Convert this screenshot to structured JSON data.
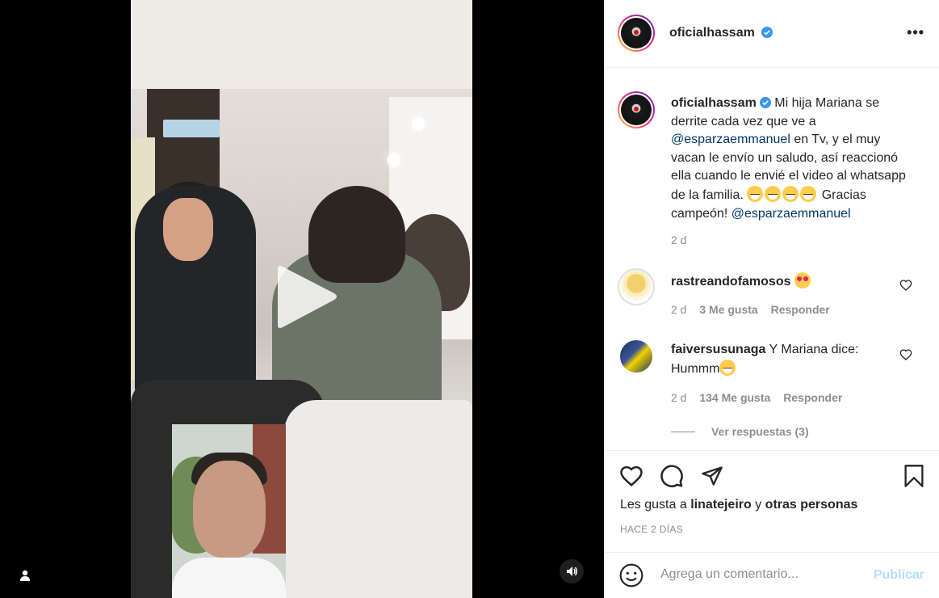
{
  "post": {
    "username": "oficialhassam",
    "more_label": "•••"
  },
  "caption": {
    "username": "oficialhassam",
    "text_before_mention": "Mi hija Mariana se derrite cada vez que ve a",
    "mention1": "@esparzaemmanuel",
    "text_middle": "en Tv, y el muy vacan le envío un saludo, así reaccionó ella cuando le envié el video al whatsapp de la familia.",
    "text_after_emojis": "Gracias campeón!",
    "mention2": "@esparzaemmanuel",
    "time": "2 d"
  },
  "comments": [
    {
      "username": "rastreandofamosos",
      "text": "",
      "time": "2 d",
      "likes": "3 Me gusta",
      "reply": "Responder"
    },
    {
      "username": "faiversusunaga",
      "text": "Y Mariana dice: Hummm",
      "time": "2 d",
      "likes": "134 Me gusta",
      "reply": "Responder",
      "view_replies": "Ver respuestas (3)"
    }
  ],
  "likes_line": {
    "prefix": "Les gusta a",
    "user": "linatejeiro",
    "conj": "y",
    "others": "otras personas"
  },
  "time_ago": "HACE 2 DÍAS",
  "comment_input": {
    "placeholder": "Agrega un comentario...",
    "publish": "Publicar"
  },
  "colors": {
    "link": "#00376b",
    "verified": "#3897f0",
    "publish_disabled": "#b2dffc"
  }
}
